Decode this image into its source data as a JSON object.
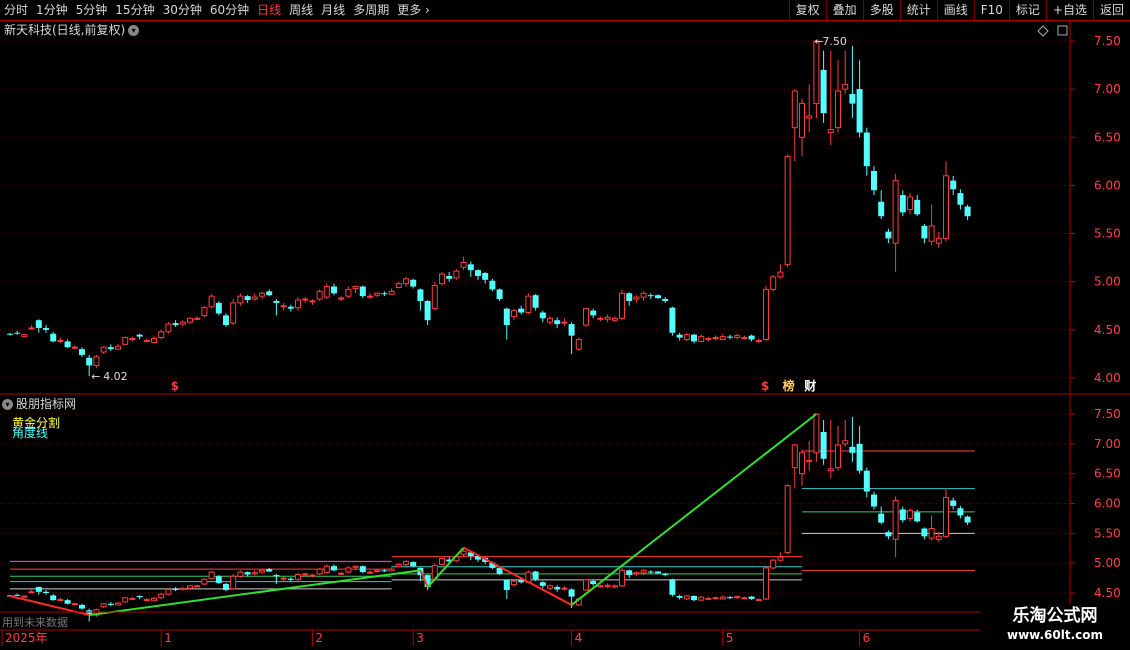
{
  "toolbar": {
    "timeframes": [
      "分时",
      "1分钟",
      "5分钟",
      "15分钟",
      "30分钟",
      "60分钟",
      "日线",
      "周线",
      "月线",
      "多周期",
      "更多"
    ],
    "active_index": 6,
    "right_buttons": [
      "复权",
      "叠加",
      "多股",
      "统计",
      "画线",
      "F10",
      "标记",
      "+自选",
      "返回"
    ]
  },
  "main_panel": {
    "title": "新天科技(日线,前复权)",
    "high_label": "7.50",
    "low_label": "4.02",
    "y_ticks": [
      "7.50",
      "7.00",
      "6.50",
      "6.00",
      "5.50",
      "5.00",
      "4.50",
      "4.00"
    ],
    "markers": [
      {
        "text": "$",
        "color": "#ff3b3b"
      },
      {
        "text": "财",
        "color": "#ffffff"
      },
      {
        "text": "$",
        "color": "#ff3b3b"
      },
      {
        "text": "榜",
        "color": "#ffcc66"
      }
    ]
  },
  "indicator_panel": {
    "title": "股朋指标网",
    "legend": [
      "黄金分割",
      "角度线"
    ],
    "y_ticks": [
      "7.50",
      "7.00",
      "6.50",
      "6.00",
      "5.50",
      "5.00",
      "4.50"
    ]
  },
  "footer": {
    "note": "用到未来数据",
    "x_labels": [
      "2025年",
      "1",
      "2",
      "3",
      "4",
      "5",
      "6"
    ]
  },
  "watermark": {
    "title": "乐淘公式网",
    "url": "www.60lt.com"
  },
  "colors": {
    "up": "#ff3c3c",
    "down": "#54ffff",
    "axis": "#b00000",
    "zigup": "#33dd33",
    "zigdown": "#ff2a2a"
  },
  "chart_data": {
    "type": "candlestick",
    "x_unit": "trading day index",
    "ylim": [
      3.9,
      7.65
    ],
    "candles": [
      [
        0,
        4.46,
        4.45,
        4.47,
        4.44
      ],
      [
        1,
        4.47,
        4.46,
        4.49,
        4.45
      ],
      [
        2,
        4.43,
        4.45,
        4.46,
        4.42
      ],
      [
        3,
        4.51,
        4.52,
        4.55,
        4.5
      ],
      [
        4,
        4.6,
        4.52,
        4.61,
        4.47
      ],
      [
        5,
        4.52,
        4.5,
        4.55,
        4.47
      ],
      [
        6,
        4.46,
        4.38,
        4.48,
        4.37
      ],
      [
        7,
        4.38,
        4.39,
        4.42,
        4.36
      ],
      [
        8,
        4.38,
        4.32,
        4.4,
        4.31
      ],
      [
        9,
        4.32,
        4.32,
        4.34,
        4.3
      ],
      [
        10,
        4.3,
        4.24,
        4.32,
        4.22
      ],
      [
        11,
        4.21,
        4.13,
        4.24,
        4.02
      ],
      [
        12,
        4.13,
        4.22,
        4.24,
        4.1
      ],
      [
        13,
        4.27,
        4.32,
        4.33,
        4.25
      ],
      [
        14,
        4.32,
        4.3,
        4.35,
        4.28
      ],
      [
        15,
        4.3,
        4.33,
        4.35,
        4.29
      ],
      [
        16,
        4.35,
        4.42,
        4.43,
        4.34
      ],
      [
        17,
        4.4,
        4.41,
        4.43,
        4.38
      ],
      [
        18,
        4.45,
        4.43,
        4.46,
        4.4
      ],
      [
        19,
        4.38,
        4.39,
        4.41,
        4.37
      ],
      [
        20,
        4.37,
        4.41,
        4.44,
        4.36
      ],
      [
        21,
        4.42,
        4.48,
        4.5,
        4.4
      ],
      [
        22,
        4.48,
        4.56,
        4.58,
        4.46
      ],
      [
        23,
        4.57,
        4.55,
        4.6,
        4.53
      ],
      [
        24,
        4.56,
        4.58,
        4.6,
        4.54
      ],
      [
        25,
        4.58,
        4.62,
        4.63,
        4.56
      ],
      [
        26,
        4.62,
        4.62,
        4.64,
        4.6
      ],
      [
        27,
        4.65,
        4.73,
        4.75,
        4.63
      ],
      [
        28,
        4.74,
        4.85,
        4.87,
        4.72
      ],
      [
        29,
        4.78,
        4.67,
        4.8,
        4.65
      ],
      [
        30,
        4.65,
        4.55,
        4.67,
        4.53
      ],
      [
        31,
        4.57,
        4.78,
        4.82,
        4.55
      ],
      [
        32,
        4.78,
        4.85,
        4.88,
        4.75
      ],
      [
        33,
        4.85,
        4.81,
        4.86,
        4.78
      ],
      [
        34,
        4.82,
        4.84,
        4.88,
        4.8
      ],
      [
        35,
        4.85,
        4.88,
        4.9,
        4.82
      ],
      [
        36,
        4.9,
        4.86,
        4.92,
        4.85
      ],
      [
        37,
        4.8,
        4.78,
        4.82,
        4.65
      ],
      [
        38,
        4.74,
        4.75,
        4.78,
        4.7
      ],
      [
        39,
        4.74,
        4.72,
        4.76,
        4.69
      ],
      [
        40,
        4.73,
        4.81,
        4.84,
        4.7
      ],
      [
        41,
        4.81,
        4.82,
        4.84,
        4.78
      ],
      [
        42,
        4.79,
        4.8,
        4.82,
        4.76
      ],
      [
        43,
        4.82,
        4.9,
        4.92,
        4.8
      ],
      [
        44,
        4.84,
        4.95,
        4.98,
        4.82
      ],
      [
        45,
        4.95,
        4.88,
        4.98,
        4.86
      ],
      [
        46,
        4.82,
        4.83,
        4.85,
        4.8
      ],
      [
        47,
        4.85,
        4.92,
        4.95,
        4.83
      ],
      [
        48,
        4.93,
        4.95,
        4.96,
        4.88
      ],
      [
        49,
        4.95,
        4.85,
        4.96,
        4.83
      ],
      [
        50,
        4.85,
        4.85,
        4.88,
        4.82
      ],
      [
        51,
        4.86,
        4.88,
        4.89,
        4.84
      ],
      [
        52,
        4.88,
        4.87,
        4.9,
        4.85
      ],
      [
        53,
        4.87,
        4.9,
        4.93,
        4.86
      ],
      [
        54,
        4.94,
        4.98,
        5.0,
        4.93
      ],
      [
        55,
        4.98,
        5.03,
        5.05,
        4.95
      ],
      [
        56,
        5.02,
        4.95,
        5.03,
        4.93
      ],
      [
        57,
        4.92,
        4.8,
        4.93,
        4.7
      ],
      [
        58,
        4.8,
        4.6,
        4.81,
        4.55
      ],
      [
        59,
        4.72,
        4.96,
        5.0,
        4.7
      ],
      [
        60,
        4.98,
        5.08,
        5.1,
        4.96
      ],
      [
        61,
        5.06,
        5.03,
        5.1,
        5.0
      ],
      [
        62,
        5.04,
        5.11,
        5.13,
        5.02
      ],
      [
        63,
        5.15,
        5.2,
        5.26,
        5.12
      ],
      [
        64,
        5.18,
        5.12,
        5.21,
        5.05
      ],
      [
        65,
        5.12,
        5.06,
        5.13,
        5.02
      ],
      [
        66,
        5.09,
        5.02,
        5.1,
        4.98
      ],
      [
        67,
        5.01,
        4.92,
        5.03,
        4.9
      ],
      [
        68,
        4.92,
        4.82,
        4.93,
        4.8
      ],
      [
        69,
        4.72,
        4.55,
        4.73,
        4.4
      ],
      [
        70,
        4.64,
        4.7,
        4.72,
        4.6
      ],
      [
        71,
        4.72,
        4.68,
        4.75,
        4.66
      ],
      [
        72,
        4.68,
        4.85,
        4.88,
        4.66
      ],
      [
        73,
        4.86,
        4.73,
        4.87,
        4.7
      ],
      [
        74,
        4.68,
        4.62,
        4.7,
        4.58
      ],
      [
        75,
        4.58,
        4.62,
        4.64,
        4.55
      ],
      [
        76,
        4.6,
        4.56,
        4.63,
        4.52
      ],
      [
        77,
        4.57,
        4.58,
        4.62,
        4.54
      ],
      [
        78,
        4.56,
        4.44,
        4.58,
        4.25
      ],
      [
        79,
        4.3,
        4.4,
        4.42,
        4.28
      ],
      [
        80,
        4.55,
        4.72,
        4.73,
        4.53
      ],
      [
        81,
        4.7,
        4.65,
        4.72,
        4.62
      ],
      [
        82,
        4.61,
        4.62,
        4.64,
        4.59
      ],
      [
        83,
        4.61,
        4.63,
        4.66,
        4.58
      ],
      [
        84,
        4.6,
        4.62,
        4.64,
        4.58
      ],
      [
        85,
        4.62,
        4.88,
        4.92,
        4.6
      ],
      [
        86,
        4.88,
        4.8,
        4.89,
        4.75
      ],
      [
        87,
        4.82,
        4.84,
        4.86,
        4.78
      ],
      [
        88,
        4.84,
        4.88,
        4.9,
        4.8
      ],
      [
        89,
        4.86,
        4.85,
        4.88,
        4.82
      ],
      [
        90,
        4.86,
        4.83,
        4.87,
        4.82
      ],
      [
        91,
        4.82,
        4.8,
        4.84,
        4.78
      ],
      [
        92,
        4.73,
        4.47,
        4.74,
        4.44
      ],
      [
        93,
        4.45,
        4.42,
        4.47,
        4.39
      ],
      [
        94,
        4.4,
        4.45,
        4.47,
        4.38
      ],
      [
        95,
        4.45,
        4.38,
        4.46,
        4.36
      ],
      [
        96,
        4.38,
        4.43,
        4.45,
        4.37
      ],
      [
        97,
        4.4,
        4.41,
        4.43,
        4.38
      ],
      [
        98,
        4.41,
        4.42,
        4.44,
        4.39
      ],
      [
        99,
        4.4,
        4.43,
        4.46,
        4.39
      ],
      [
        100,
        4.43,
        4.42,
        4.45,
        4.4
      ],
      [
        101,
        4.42,
        4.44,
        4.46,
        4.4
      ],
      [
        102,
        4.42,
        4.42,
        4.44,
        4.4
      ],
      [
        103,
        4.44,
        4.4,
        4.45,
        4.38
      ],
      [
        104,
        4.38,
        4.39,
        4.41,
        4.36
      ],
      [
        105,
        4.4,
        4.92,
        4.96,
        4.38
      ],
      [
        106,
        4.92,
        5.05,
        5.07,
        4.9
      ],
      [
        107,
        5.05,
        5.1,
        5.18,
        5.03
      ],
      [
        108,
        5.18,
        6.3,
        6.32,
        5.15
      ],
      [
        109,
        6.6,
        6.98,
        7.0,
        6.25
      ],
      [
        110,
        6.5,
        6.85,
        6.9,
        6.3
      ],
      [
        111,
        6.7,
        6.72,
        7.05,
        6.55
      ],
      [
        112,
        6.85,
        7.5,
        7.5,
        6.7
      ],
      [
        113,
        7.2,
        6.75,
        7.4,
        6.65
      ],
      [
        114,
        6.55,
        6.58,
        7.4,
        6.42
      ],
      [
        115,
        6.6,
        6.98,
        7.3,
        6.55
      ],
      [
        116,
        7.0,
        7.05,
        7.4,
        6.95
      ],
      [
        117,
        6.95,
        6.85,
        7.45,
        6.7
      ],
      [
        118,
        7.0,
        6.55,
        7.3,
        6.5
      ],
      [
        119,
        6.55,
        6.2,
        6.6,
        6.1
      ],
      [
        120,
        6.15,
        5.95,
        6.2,
        5.9
      ],
      [
        121,
        5.83,
        5.68,
        5.95,
        5.65
      ],
      [
        122,
        5.52,
        5.45,
        5.55,
        5.4
      ],
      [
        123,
        5.4,
        6.05,
        6.12,
        5.1
      ],
      [
        124,
        5.9,
        5.72,
        5.95,
        5.68
      ],
      [
        125,
        5.75,
        5.88,
        5.92,
        5.7
      ],
      [
        126,
        5.85,
        5.7,
        5.9,
        5.68
      ],
      [
        127,
        5.58,
        5.45,
        5.6,
        5.4
      ],
      [
        128,
        5.42,
        5.58,
        5.8,
        5.38
      ],
      [
        129,
        5.4,
        5.45,
        5.52,
        5.35
      ],
      [
        130,
        5.45,
        6.1,
        6.25,
        5.42
      ],
      [
        131,
        6.05,
        5.96,
        6.1,
        5.9
      ],
      [
        132,
        5.92,
        5.8,
        5.96,
        5.75
      ],
      [
        133,
        5.78,
        5.68,
        5.8,
        5.64
      ]
    ],
    "zigzag": [
      [
        0,
        4.45
      ],
      [
        11,
        4.13
      ],
      [
        57,
        4.88
      ],
      [
        58,
        4.6
      ],
      [
        63,
        5.26
      ],
      [
        78,
        4.3
      ],
      [
        112,
        7.5
      ]
    ],
    "horizontal_levels": [
      {
        "from": 0,
        "to": 53,
        "y": 5.03,
        "color": "#ff55aa"
      },
      {
        "from": 0,
        "to": 53,
        "y": 4.9,
        "color": "#ff4040"
      },
      {
        "from": 0,
        "to": 53,
        "y": 4.78,
        "color": "#33cc66"
      },
      {
        "from": 0,
        "to": 53,
        "y": 4.69,
        "color": "#33cccc"
      },
      {
        "from": 0,
        "to": 53,
        "y": 4.57,
        "color": "#cccccc"
      },
      {
        "from": 53,
        "to": 110,
        "y": 5.11,
        "color": "#ff4040"
      },
      {
        "from": 53,
        "to": 110,
        "y": 4.94,
        "color": "#33cccc"
      },
      {
        "from": 53,
        "to": 110,
        "y": 4.82,
        "color": "#33cc66"
      },
      {
        "from": 53,
        "to": 110,
        "y": 4.72,
        "color": "#cccccc"
      },
      {
        "from": 110,
        "to": 134,
        "y": 6.88,
        "color": "#ff4040"
      },
      {
        "from": 110,
        "to": 134,
        "y": 6.25,
        "color": "#33cccc"
      },
      {
        "from": 110,
        "to": 134,
        "y": 5.86,
        "color": "#33cc66"
      },
      {
        "from": 110,
        "to": 134,
        "y": 5.5,
        "color": "#cccccc"
      },
      {
        "from": 110,
        "to": 134,
        "y": 4.88,
        "color": "#ff4040"
      }
    ],
    "marker_x": [
      23,
      111,
      105,
      108
    ],
    "x_label_index": [
      0,
      21,
      42,
      56,
      78,
      99,
      118
    ]
  }
}
